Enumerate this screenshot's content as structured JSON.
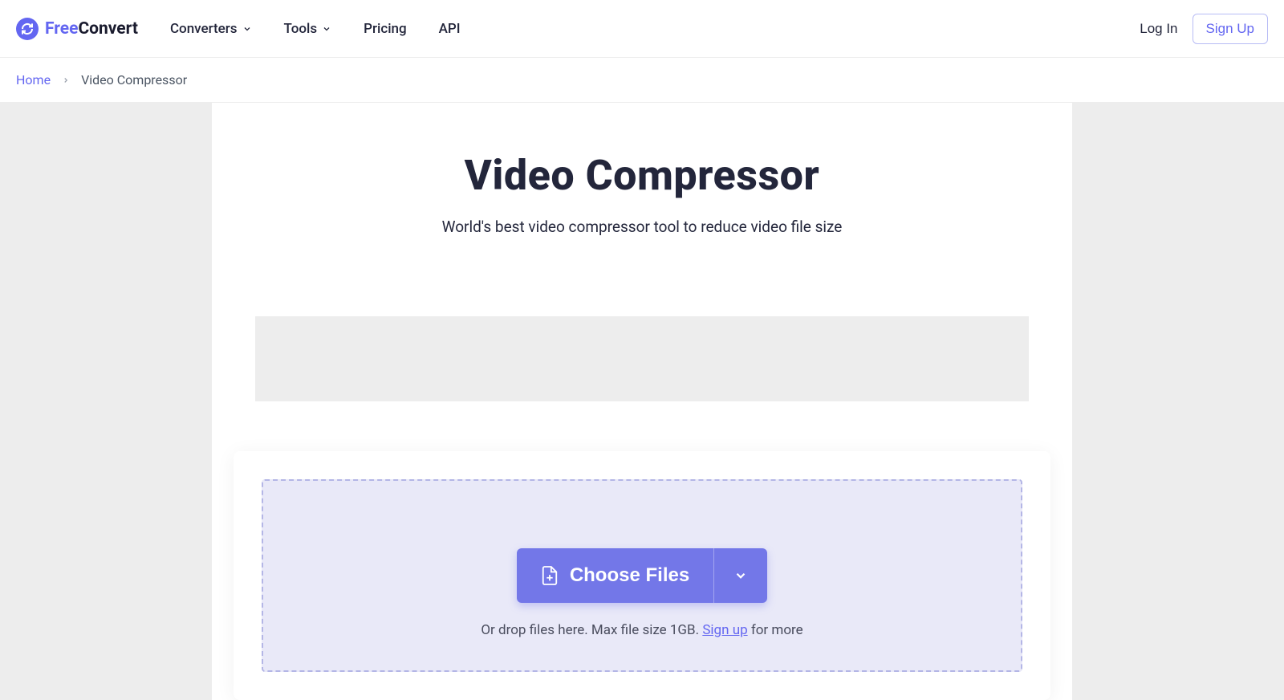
{
  "header": {
    "logo_free": "Free",
    "logo_convert": "Convert",
    "nav": {
      "converters": "Converters",
      "tools": "Tools",
      "pricing": "Pricing",
      "api": "API"
    },
    "auth": {
      "login": "Log In",
      "signup": "Sign Up"
    }
  },
  "breadcrumb": {
    "home": "Home",
    "current": "Video Compressor"
  },
  "hero": {
    "title": "Video Compressor",
    "subtitle": "World's best video compressor tool to reduce video file size"
  },
  "dropzone": {
    "choose_files": "Choose Files",
    "drop_text_prefix": "Or drop files here. Max file size 1GB. ",
    "signup_link": "Sign up",
    "drop_text_suffix": " for more"
  }
}
